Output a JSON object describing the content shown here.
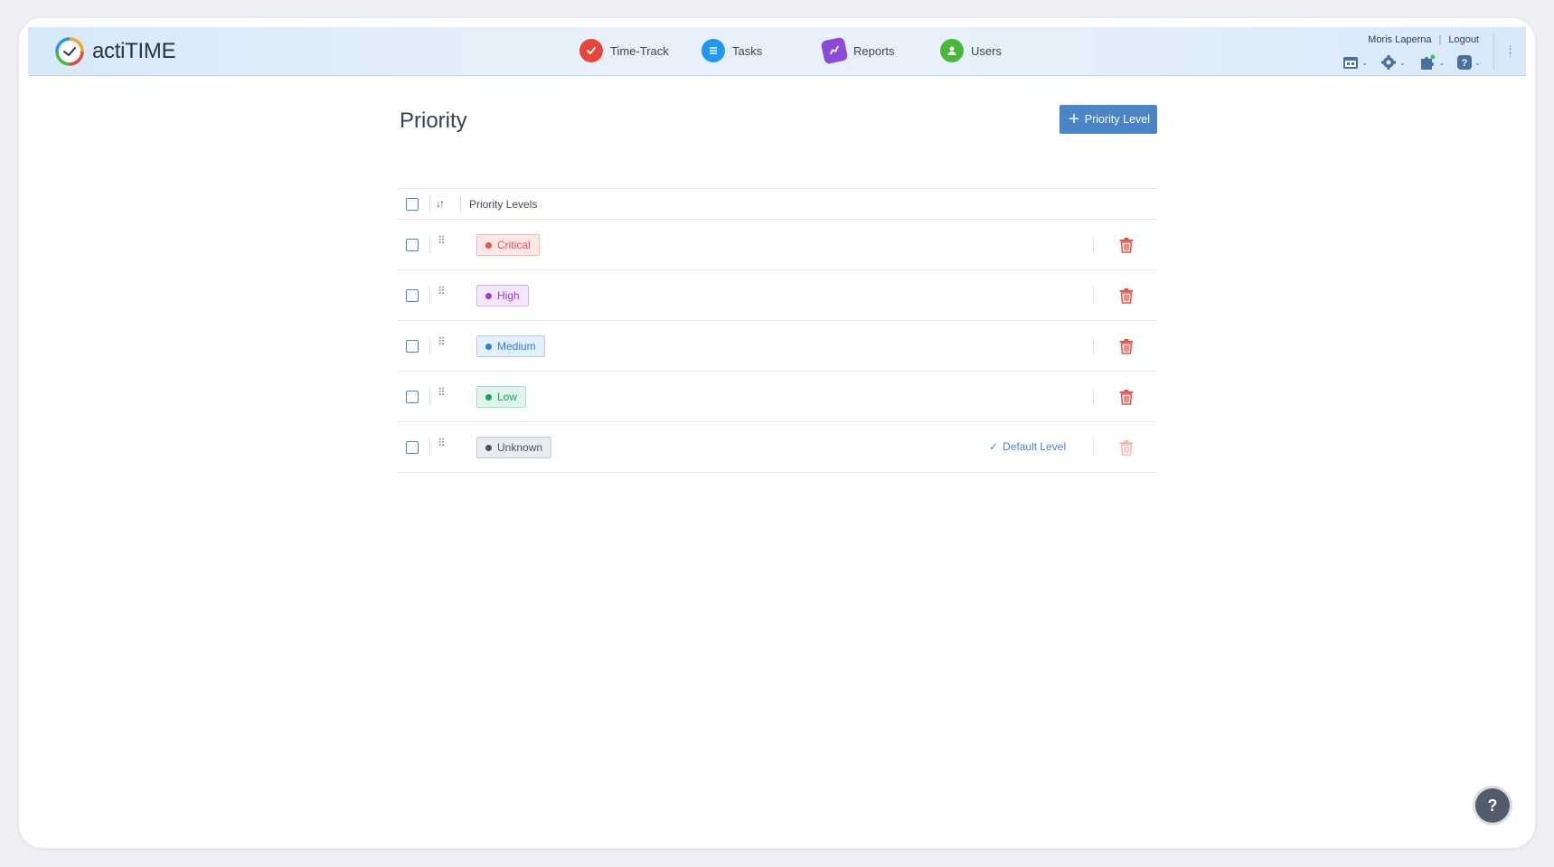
{
  "app": {
    "name": "actiTIME"
  },
  "nav": [
    {
      "label": "Time-Track",
      "icon": "time-track-icon",
      "color": "#e8453c"
    },
    {
      "label": "Tasks",
      "icon": "tasks-icon",
      "color": "#2196f3"
    },
    {
      "label": "Reports",
      "icon": "reports-icon",
      "color": "#8a4bd9"
    },
    {
      "label": "Users",
      "icon": "users-icon",
      "color": "#49b83a"
    }
  ],
  "user": {
    "name": "Moris Laperna",
    "separator": "|",
    "logout": "Logout"
  },
  "page": {
    "title": "Priority",
    "add_button": "Priority Level"
  },
  "table": {
    "header": "Priority Levels",
    "rows": [
      {
        "label": "Critical",
        "color": "#e5534b",
        "bg": "#fde8e7",
        "border": "#f5b8b4",
        "default": false
      },
      {
        "label": "High",
        "color": "#9b3fd6",
        "bg": "#f4e6fc",
        "border": "#d9b0f1",
        "default": false
      },
      {
        "label": "Medium",
        "color": "#2c7fe0",
        "bg": "#e4effc",
        "border": "#b3d0f3",
        "default": false
      },
      {
        "label": "Low",
        "color": "#19a364",
        "bg": "#e0f5ea",
        "border": "#a9dfc3",
        "default": false
      },
      {
        "label": "Unknown",
        "color": "#4a5260",
        "bg": "#e9ecef",
        "border": "#c7ccd3",
        "default": true
      }
    ],
    "default_label": "Default Level"
  },
  "help": "?"
}
